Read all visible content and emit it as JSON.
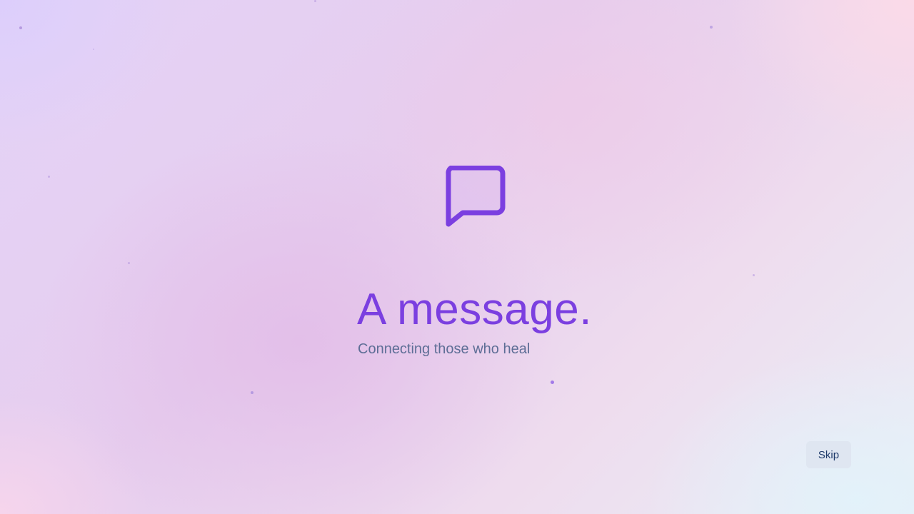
{
  "splash": {
    "icon": "message-bubble-icon",
    "title": "A message.",
    "subtitle": "Connecting those who heal"
  },
  "actions": {
    "skip_label": "Skip"
  },
  "colors": {
    "accent": "#7b3fe0",
    "subtitle": "#5e6e96",
    "skip_text": "#1e3a6a",
    "skip_bg": "#dee4f0"
  }
}
